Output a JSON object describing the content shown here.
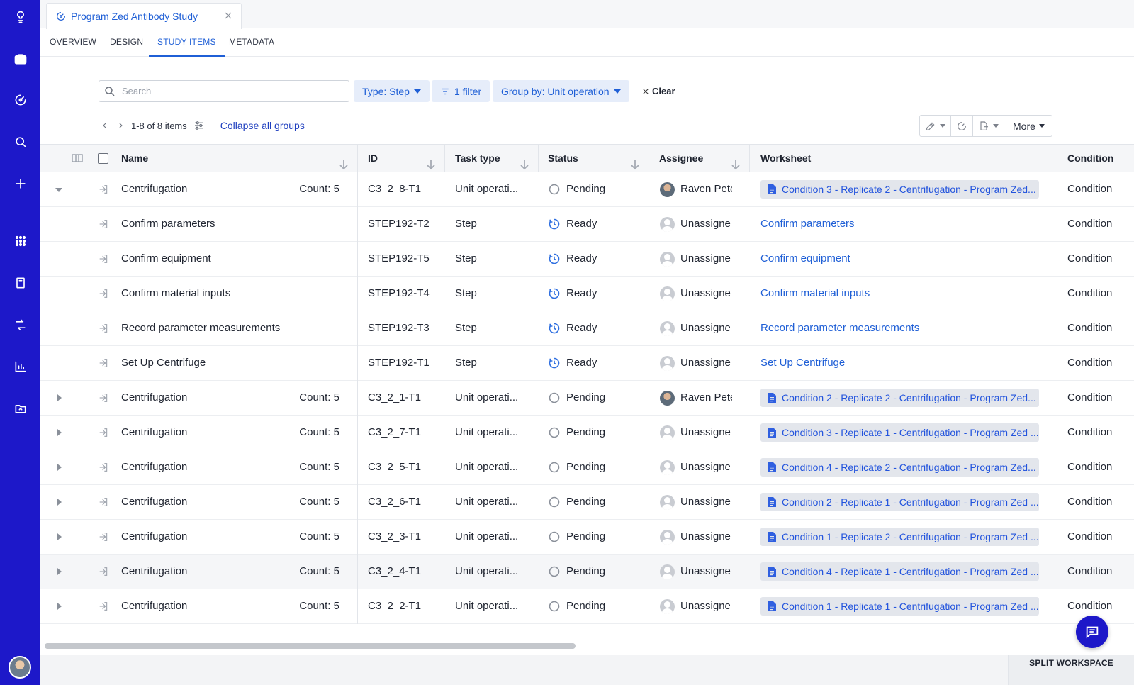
{
  "document_tab": {
    "title": "Program Zed Antibody Study"
  },
  "subnav": [
    {
      "label": "OVERVIEW",
      "active": false
    },
    {
      "label": "DESIGN",
      "active": false
    },
    {
      "label": "STUDY ITEMS",
      "active": true
    },
    {
      "label": "METADATA",
      "active": false
    }
  ],
  "toolbar": {
    "search_placeholder": "Search",
    "type_filter": "Type: Step",
    "filter_count": "1 filter",
    "group_by": "Group by: Unit operation",
    "clear": "Clear"
  },
  "pager": {
    "range": "1-8 of 8 items",
    "collapse": "Collapse all groups"
  },
  "actions": {
    "more": "More"
  },
  "columns": {
    "name": "Name",
    "id": "ID",
    "task_type": "Task type",
    "status": "Status",
    "assignee": "Assignee",
    "worksheet": "Worksheet",
    "condition": "Condition"
  },
  "rows": [
    {
      "expander": "down",
      "name": "Centrifugation",
      "count": "Count: 5",
      "id": "C3_2_8-T1",
      "task_type": "Unit operati...",
      "status": "Pending",
      "status_kind": "pending",
      "assignee": "Raven Pete",
      "avatar": "photo",
      "worksheet": "Condition 3 - Replicate 2 - Centrifugation - Program Zed...",
      "worksheet_kind": "chip",
      "condition": "Condition",
      "highlight": false
    },
    {
      "expander": "none",
      "name": "Confirm parameters",
      "count": "",
      "id": "STEP192-T2",
      "task_type": "Step",
      "status": "Ready",
      "status_kind": "ready",
      "assignee": "Unassigne",
      "avatar": "blank",
      "worksheet": "Confirm parameters",
      "worksheet_kind": "link",
      "condition": "Condition",
      "highlight": false
    },
    {
      "expander": "none",
      "name": "Confirm equipment",
      "count": "",
      "id": "STEP192-T5",
      "task_type": "Step",
      "status": "Ready",
      "status_kind": "ready",
      "assignee": "Unassigne",
      "avatar": "blank",
      "worksheet": "Confirm equipment",
      "worksheet_kind": "link",
      "condition": "Condition",
      "highlight": false
    },
    {
      "expander": "none",
      "name": "Confirm material inputs",
      "count": "",
      "id": "STEP192-T4",
      "task_type": "Step",
      "status": "Ready",
      "status_kind": "ready",
      "assignee": "Unassigne",
      "avatar": "blank",
      "worksheet": "Confirm material inputs",
      "worksheet_kind": "link",
      "condition": "Condition",
      "highlight": false
    },
    {
      "expander": "none",
      "name": "Record parameter measurements",
      "count": "",
      "id": "STEP192-T3",
      "task_type": "Step",
      "status": "Ready",
      "status_kind": "ready",
      "assignee": "Unassigne",
      "avatar": "blank",
      "worksheet": "Record parameter measurements",
      "worksheet_kind": "link",
      "condition": "Condition",
      "highlight": false
    },
    {
      "expander": "none",
      "name": "Set Up Centrifuge",
      "count": "",
      "id": "STEP192-T1",
      "task_type": "Step",
      "status": "Ready",
      "status_kind": "ready",
      "assignee": "Unassigne",
      "avatar": "blank",
      "worksheet": "Set Up Centrifuge",
      "worksheet_kind": "link",
      "condition": "Condition",
      "highlight": false
    },
    {
      "expander": "right",
      "name": "Centrifugation",
      "count": "Count: 5",
      "id": "C3_2_1-T1",
      "task_type": "Unit operati...",
      "status": "Pending",
      "status_kind": "pending",
      "assignee": "Raven Pete",
      "avatar": "photo",
      "worksheet": "Condition 2 - Replicate 2 - Centrifugation - Program Zed...",
      "worksheet_kind": "chip",
      "condition": "Condition",
      "highlight": false
    },
    {
      "expander": "right",
      "name": "Centrifugation",
      "count": "Count: 5",
      "id": "C3_2_7-T1",
      "task_type": "Unit operati...",
      "status": "Pending",
      "status_kind": "pending",
      "assignee": "Unassigne",
      "avatar": "blank",
      "worksheet": "Condition 3 - Replicate 1 - Centrifugation - Program Zed ...",
      "worksheet_kind": "chip",
      "condition": "Condition",
      "highlight": false
    },
    {
      "expander": "right",
      "name": "Centrifugation",
      "count": "Count: 5",
      "id": "C3_2_5-T1",
      "task_type": "Unit operati...",
      "status": "Pending",
      "status_kind": "pending",
      "assignee": "Unassigne",
      "avatar": "blank",
      "worksheet": "Condition 4 - Replicate 2 - Centrifugation - Program Zed...",
      "worksheet_kind": "chip",
      "condition": "Condition",
      "highlight": false
    },
    {
      "expander": "right",
      "name": "Centrifugation",
      "count": "Count: 5",
      "id": "C3_2_6-T1",
      "task_type": "Unit operati...",
      "status": "Pending",
      "status_kind": "pending",
      "assignee": "Unassigne",
      "avatar": "blank",
      "worksheet": "Condition 2 - Replicate 1 - Centrifugation - Program Zed ...",
      "worksheet_kind": "chip",
      "condition": "Condition",
      "highlight": false
    },
    {
      "expander": "right",
      "name": "Centrifugation",
      "count": "Count: 5",
      "id": "C3_2_3-T1",
      "task_type": "Unit operati...",
      "status": "Pending",
      "status_kind": "pending",
      "assignee": "Unassigne",
      "avatar": "blank",
      "worksheet": "Condition 1 - Replicate 2 - Centrifugation - Program Zed ...",
      "worksheet_kind": "chip",
      "condition": "Condition",
      "highlight": false
    },
    {
      "expander": "right",
      "name": "Centrifugation",
      "count": "Count: 5",
      "id": "C3_2_4-T1",
      "task_type": "Unit operati...",
      "status": "Pending",
      "status_kind": "pending",
      "assignee": "Unassigne",
      "avatar": "blank",
      "worksheet": "Condition 4 - Replicate 1 - Centrifugation - Program Zed ...",
      "worksheet_kind": "chip",
      "condition": "Condition",
      "highlight": true
    },
    {
      "expander": "right",
      "name": "Centrifugation",
      "count": "Count: 5",
      "id": "C3_2_2-T1",
      "task_type": "Unit operati...",
      "status": "Pending",
      "status_kind": "pending",
      "assignee": "Unassigne",
      "avatar": "blank",
      "worksheet": "Condition 1 - Replicate 1 - Centrifugation - Program Zed ...",
      "worksheet_kind": "chip",
      "condition": "Condition",
      "highlight": false
    }
  ],
  "footer": {
    "split_workspace": "SPLIT WORKSPACE"
  },
  "colors": {
    "rail": "#1d18c9",
    "accent": "#1f5fd6",
    "ready": "#2f6fe0",
    "pending": "#8a909a"
  }
}
